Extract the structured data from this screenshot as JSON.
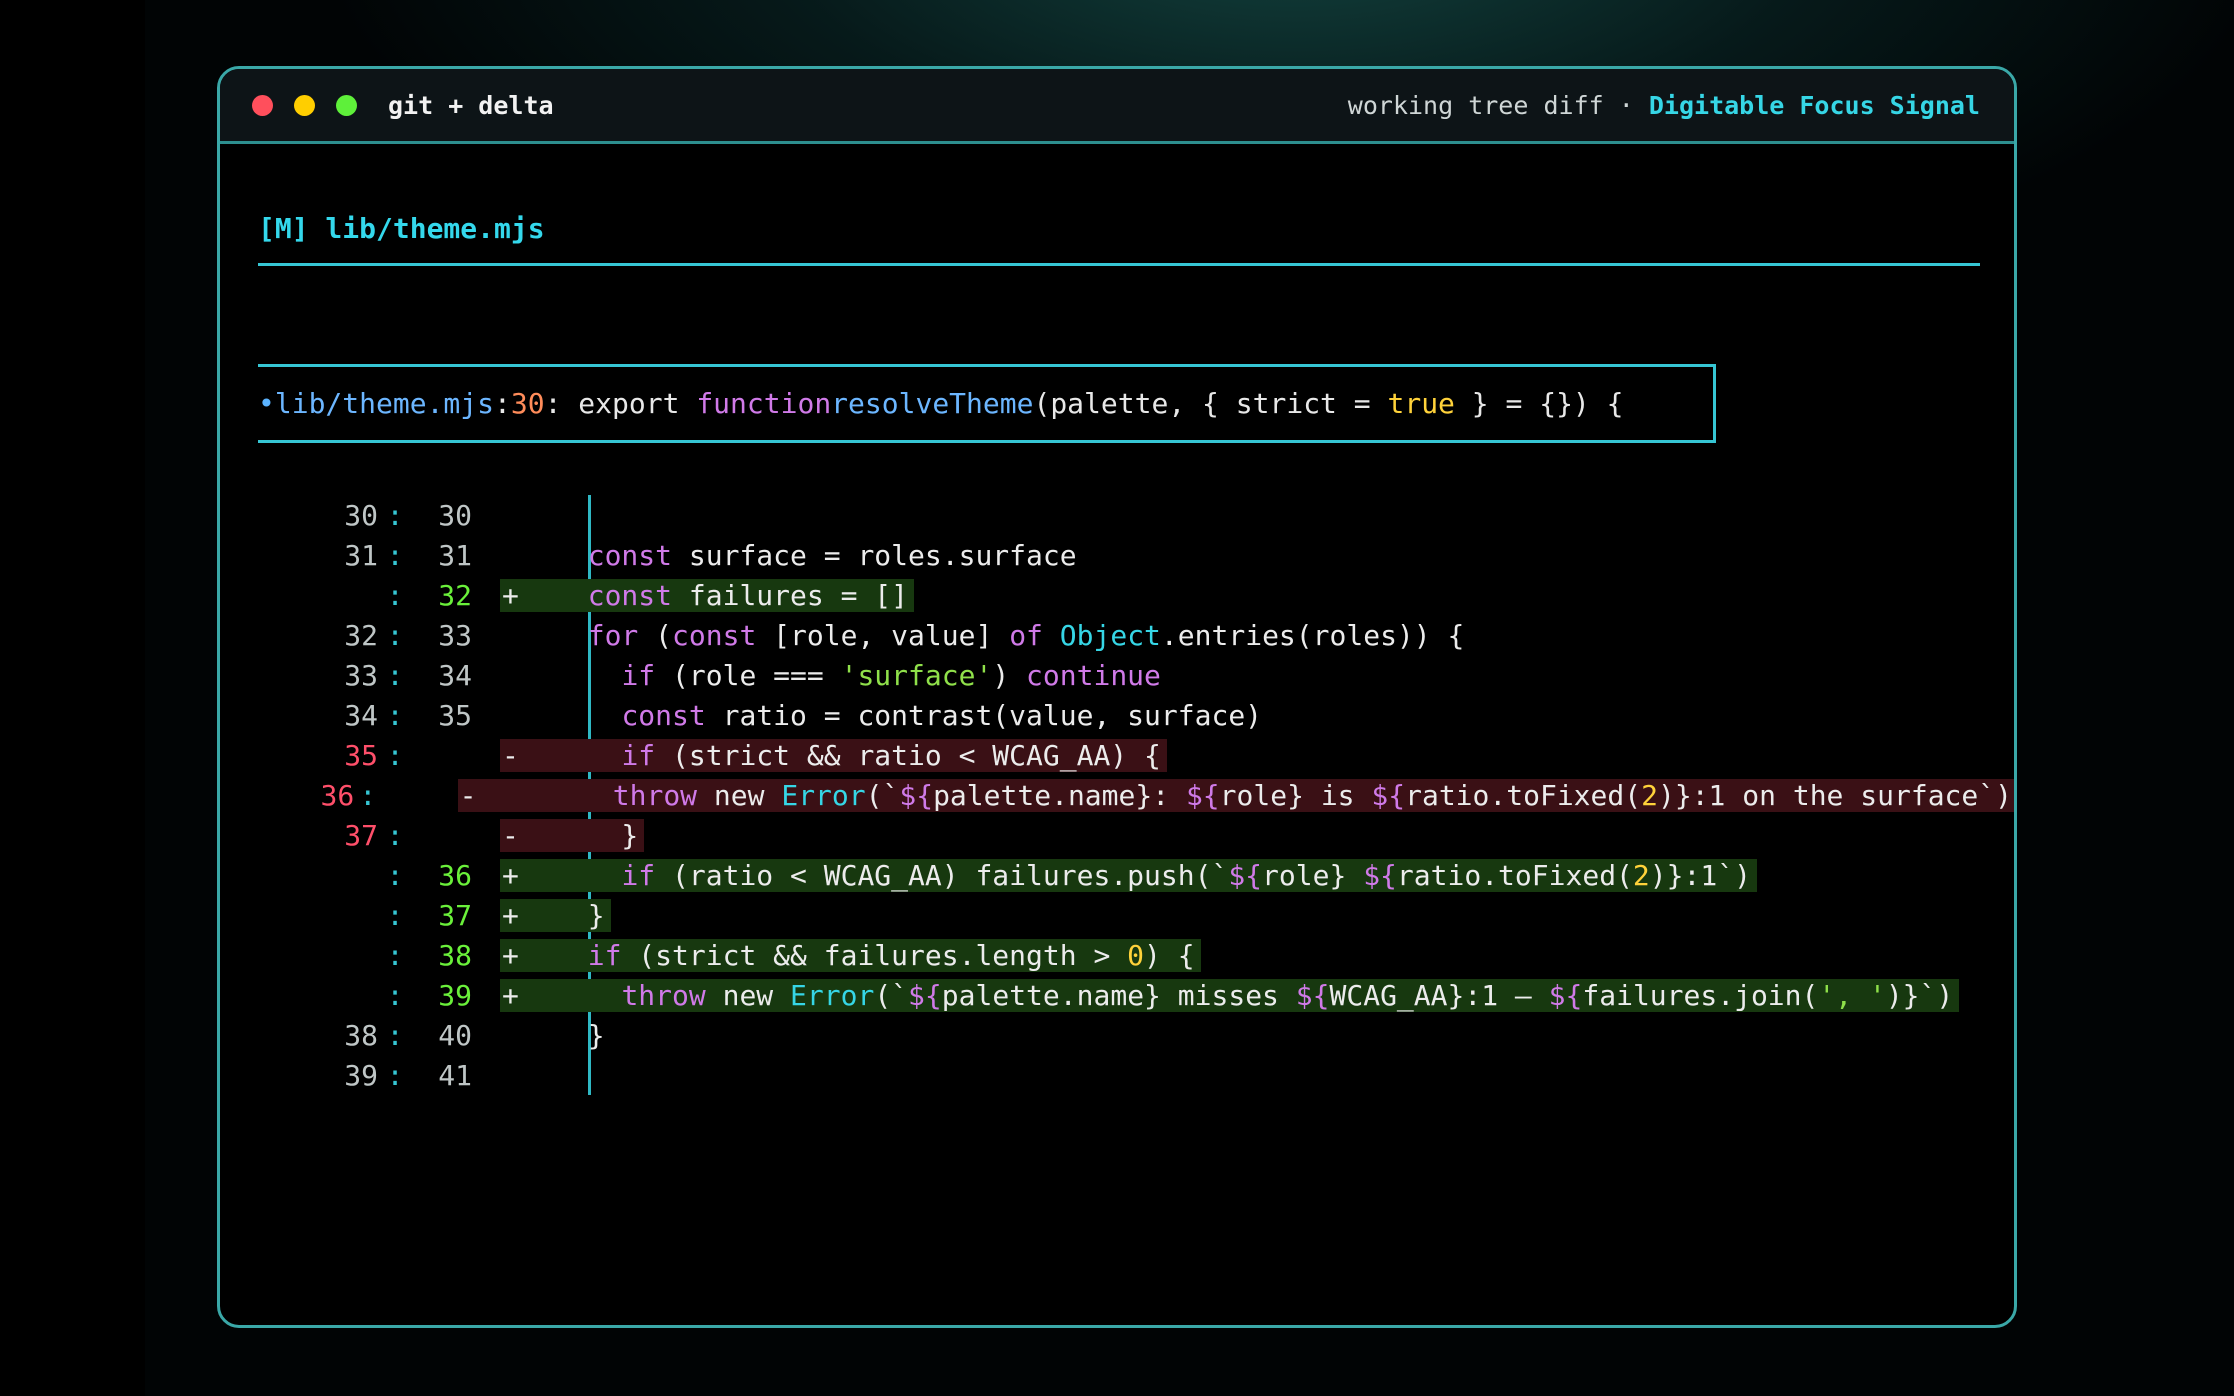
{
  "window": {
    "title": "git + delta",
    "subtitle": "working tree diff",
    "separator": "·",
    "theme_name": "Digitable Focus Signal"
  },
  "file": {
    "header": "[M] lib/theme.mjs"
  },
  "hunk": {
    "bullet": "•",
    "file": "lib/theme.mjs",
    "colon1": ":",
    "line": "30",
    "colon2": ": export ",
    "kw_function": "function",
    "fn_name": "resolveTheme",
    "sig_a": "(palette, { strict = ",
    "bool": "true",
    "sig_b": " } = {}) {"
  },
  "rows": [
    {
      "old": "30",
      "new": "30",
      "type": "ctx",
      "code": ""
    },
    {
      "old": "31",
      "new": "31",
      "type": "ctx",
      "code": "  const surface = roles.surface"
    },
    {
      "old": "",
      "new": "32",
      "type": "add",
      "code": "  const failures = []"
    },
    {
      "old": "32",
      "new": "33",
      "type": "ctx",
      "code": "  for (const [role, value] of Object.entries(roles)) {"
    },
    {
      "old": "33",
      "new": "34",
      "type": "ctx",
      "code": "    if (role === 'surface') continue"
    },
    {
      "old": "34",
      "new": "35",
      "type": "ctx",
      "code": "    const ratio = contrast(value, surface)"
    },
    {
      "old": "35",
      "new": "",
      "type": "del",
      "code": "    if (strict && ratio < WCAG_AA) {"
    },
    {
      "old": "36",
      "new": "",
      "type": "del",
      "code": "      throw new Error(`${palette.name}: ${role} is ${ratio.toFixed(2)}:1 on the surface`)"
    },
    {
      "old": "37",
      "new": "",
      "type": "del",
      "code": "    }"
    },
    {
      "old": "",
      "new": "36",
      "type": "add",
      "code": "    if (ratio < WCAG_AA) failures.push(`${role} ${ratio.toFixed(2)}:1`)"
    },
    {
      "old": "",
      "new": "37",
      "type": "add",
      "code": "  }"
    },
    {
      "old": "",
      "new": "38",
      "type": "add",
      "code": "  if (strict && failures.length > 0) {"
    },
    {
      "old": "",
      "new": "39",
      "type": "add",
      "code": "    throw new Error(`${palette.name} misses ${WCAG_AA}:1 — ${failures.join(', ')}`)"
    },
    {
      "old": "38",
      "new": "40",
      "type": "ctx",
      "code": "  }"
    },
    {
      "old": "39",
      "new": "41",
      "type": "ctx",
      "code": ""
    }
  ],
  "colors": {
    "accent": "#36d6e6",
    "border": "#3aa8a8",
    "added_bg": "#17380f",
    "removed_bg": "#3a1015",
    "keyword": "#d07ae8",
    "string": "#8fe04a",
    "number": "#ffd23a"
  }
}
